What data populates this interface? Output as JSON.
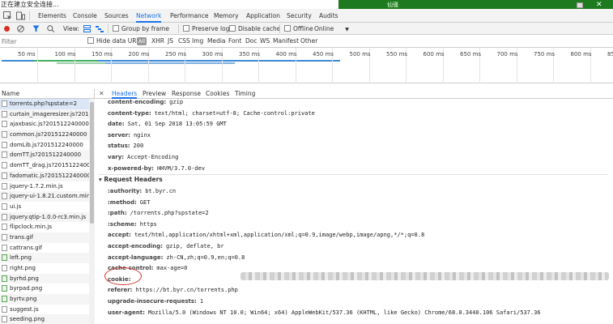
{
  "status_bar": {
    "text": "正在建立安全连接...",
    "green_text": "仙骚"
  },
  "devtools_tabs": [
    "Elements",
    "Console",
    "Sources",
    "Network",
    "Performance",
    "Memory",
    "Application",
    "Security",
    "Audits"
  ],
  "toolbar": {
    "view_label": "View:",
    "group_by_frame": "Group by frame",
    "preserve_log": "Preserve log",
    "disable_cache": "Disable cache",
    "offline": "Offline",
    "throttle": "Online"
  },
  "filter": {
    "placeholder": "Filter",
    "hide_data_urls": "Hide data URLs",
    "types": [
      "All",
      "XHR",
      "JS",
      "CSS",
      "Img",
      "Media",
      "Font",
      "Doc",
      "WS",
      "Manifest",
      "Other"
    ]
  },
  "timeline": {
    "ticks": [
      "50 ms",
      "100 ms",
      "150 ms",
      "200 ms",
      "250 ms",
      "300 ms",
      "350 ms",
      "400 ms",
      "450 ms",
      "500 ms",
      "550 ms",
      "600 ms",
      "650 ms",
      "700 ms",
      "750 ms",
      "800 ms",
      "85"
    ]
  },
  "request_list": {
    "header": "Name",
    "items": [
      {
        "name": "torrents.php?spstate=2",
        "kind": "doc"
      },
      {
        "name": "curtain_imageresizer.js?201512",
        "kind": "doc"
      },
      {
        "name": "ajaxbasic.js?201512240000",
        "kind": "doc"
      },
      {
        "name": "common.js?201512240000",
        "kind": "doc"
      },
      {
        "name": "domLib.js?201512240000",
        "kind": "doc"
      },
      {
        "name": "domTT.js?201512240000",
        "kind": "doc"
      },
      {
        "name": "domTT_drag.js?201512240000",
        "kind": "doc"
      },
      {
        "name": "fadomatic.js?201512240000",
        "kind": "doc"
      },
      {
        "name": "jquery-1.7.2.min.js",
        "kind": "doc"
      },
      {
        "name": "jquery-ui-1.8.21.custom.min.js",
        "kind": "doc"
      },
      {
        "name": "ui.js",
        "kind": "doc"
      },
      {
        "name": "jquery.qtip-1.0.0-rc3.min.js",
        "kind": "doc"
      },
      {
        "name": "flipclock.min.js",
        "kind": "doc"
      },
      {
        "name": "trans.gif",
        "kind": "doc"
      },
      {
        "name": "cattrans.gif",
        "kind": "doc"
      },
      {
        "name": "left.png",
        "kind": "img"
      },
      {
        "name": "right.png",
        "kind": "doc"
      },
      {
        "name": "byrhd.png",
        "kind": "img"
      },
      {
        "name": "byrpad.png",
        "kind": "img"
      },
      {
        "name": "byrtv.png",
        "kind": "img"
      },
      {
        "name": "suggest.js",
        "kind": "doc"
      },
      {
        "name": "seeding.png",
        "kind": "doc"
      }
    ]
  },
  "detail_tabs": [
    "Headers",
    "Preview",
    "Response",
    "Cookies",
    "Timing"
  ],
  "response_headers": [
    {
      "key": "content-encoding:",
      "value": "gzip"
    },
    {
      "key": "content-type:",
      "value": "text/html; charset=utf-8; Cache-control:private"
    },
    {
      "key": "date:",
      "value": "Sat, 01 Sep 2018 13:05:59 GMT"
    },
    {
      "key": "server:",
      "value": "nginx"
    },
    {
      "key": "status:",
      "value": "200"
    },
    {
      "key": "vary:",
      "value": "Accept-Encoding"
    },
    {
      "key": "x-powered-by:",
      "value": "HHVM/3.7.0-dev"
    }
  ],
  "request_headers_title": "▾ Request Headers",
  "request_headers": [
    {
      "key": ":authority:",
      "value": "bt.byr.cn"
    },
    {
      "key": ":method:",
      "value": "GET"
    },
    {
      "key": ":path:",
      "value": "/torrents.php?spstate=2"
    },
    {
      "key": ":scheme:",
      "value": "https"
    },
    {
      "key": "accept:",
      "value": "text/html,application/xhtml+xml,application/xml;q=0.9,image/webp,image/apng,*/*;q=0.8"
    },
    {
      "key": "accept-encoding:",
      "value": "gzip, deflate, br"
    },
    {
      "key": "accept-language:",
      "value": "zh-CN,zh;q=0.9,en;q=0.8"
    },
    {
      "key": "cache-control:",
      "value": "max-age=0"
    },
    {
      "key": "cookie:",
      "value": ""
    },
    {
      "key": "referer:",
      "value": "https://bt.byr.cn/torrents.php"
    },
    {
      "key": "upgrade-insecure-requests:",
      "value": "1"
    },
    {
      "key": "user-agent:",
      "value": "Mozilla/5.0 (Windows NT 10.0; Win64; x64) AppleWebKit/537.36 (KHTML, like Gecko) Chrome/68.0.3440.106 Safari/537.36"
    }
  ]
}
